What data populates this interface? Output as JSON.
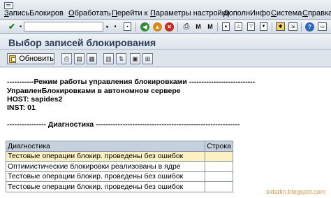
{
  "menubar": {
    "items": [
      {
        "label": "ЗаписьБлокиров",
        "ul": "З",
        "rest": "аписьБлокиров"
      },
      {
        "label": "Обработать",
        "ul": "О",
        "rest": "бработать"
      },
      {
        "label": "Перейти к",
        "ul": "П",
        "rest": "ерейти к"
      },
      {
        "label": "Параметры настройки",
        "ul": "П",
        "rest": "араметры настройки"
      },
      {
        "label": "ДополнИнфо",
        "ul": "Д",
        "rest": "ополнИнфо"
      },
      {
        "label": "Система",
        "ul": "С",
        "rest": "истема"
      },
      {
        "label": "Справка",
        "ul": "С",
        "rest": "правка"
      }
    ]
  },
  "toolbar": {
    "command_field_value": ""
  },
  "page": {
    "title": "Выбор записей блокирования"
  },
  "apptoolbar": {
    "refresh_label": "Обновить"
  },
  "list": {
    "lines": [
      "-----------Режим работы управления блокировками ---------------------------",
      "УправленБлокировками в автономном сервере",
      "HOST: sapides2",
      "INST: 01",
      "",
      "---------------- Диагностика -----------------------------------------------------------"
    ]
  },
  "diagnostics": {
    "columns": [
      "Диагностика",
      "Строка"
    ],
    "rows": [
      {
        "text": "Тестовые операции блокир. проведены без ошибок",
        "line": ""
      },
      {
        "text": "Оптимистические блокировки реализованы в ядре",
        "line": ""
      },
      {
        "text": "Тестовые операции блокир. проведены без ошибок",
        "line": ""
      },
      {
        "text": "Тестовые операции блокир. проведены без ошибок",
        "line": ""
      }
    ]
  },
  "watermark": "sidadm.blogspot.com",
  "colors": {
    "selected_row": "#fdf2c4",
    "header": "#c6d1de",
    "title": "#2a3a55"
  }
}
